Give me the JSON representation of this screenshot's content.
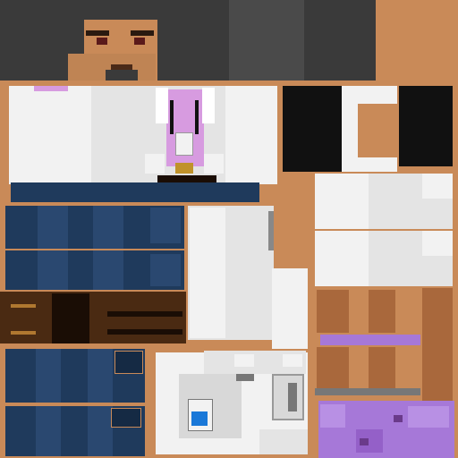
{
  "texture": {
    "kind": "pixel-art character skin texture atlas",
    "palette": {
      "skin": "#c98a58",
      "skin_dark": "#a9683c",
      "hair": "#3a3a3a",
      "hair_alt": "#4a4a4a",
      "lab_coat": "#e4e4e4",
      "lab_coat_light": "#f2f2f2",
      "shirt": "#d79be0",
      "pants": "#1f3a5c",
      "pants_light": "#2a4870",
      "shoe": "#4a2a12",
      "shoe_dark": "#1a0d05",
      "purple": "#a678d8",
      "badge_blue": "#1a78d8"
    },
    "regions": [
      "head",
      "hair",
      "torso",
      "lab-coat",
      "badge",
      "pants",
      "shoes",
      "arms",
      "sleeves",
      "legs"
    ]
  }
}
